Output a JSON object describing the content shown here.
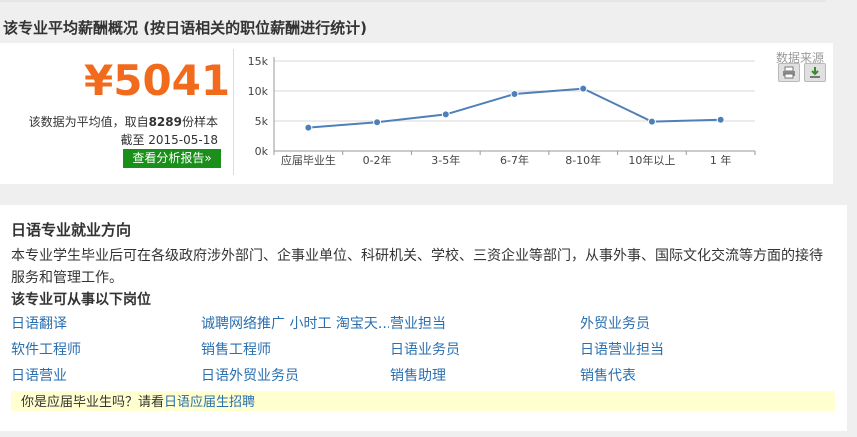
{
  "section_title": "该专业平均薪酬概况 (按日语相关的职位薪酬进行统计)",
  "salary": {
    "value": "¥5041",
    "note_prefix": "该数据为平均值，取自",
    "sample_count": "8289",
    "note_suffix": "份样本",
    "date_line": "截至 2015-05-18",
    "report_button": "查看分析报告»"
  },
  "data_source_label": "数据来源",
  "colors": {
    "accent": "#f26a1b",
    "button": "#1a8f1a",
    "link": "#2a6fb0",
    "line": "#4e7fb8"
  },
  "icons": [
    "print-icon",
    "download-icon"
  ],
  "chart_data": {
    "type": "line",
    "categories": [
      "应届毕业生",
      "0-2年",
      "3-5年",
      "6-7年",
      "8-10年",
      "10年以上",
      "1 年"
    ],
    "values": [
      3900,
      4800,
      6100,
      9500,
      10400,
      4900,
      5200
    ],
    "y_ticks": [
      "0k",
      "5k",
      "10k",
      "15k"
    ],
    "ylim": [
      0,
      15000
    ],
    "grid": true
  },
  "direction": {
    "title": "日语专业就业方向",
    "description": "本专业学生毕业后可在各级政府涉外部门、企事业单位、科研机关、学校、三资企业等部门，从事外事、国际文化交流等方面的接待服务和管理工作。",
    "positions_title": "该专业可从事以下岗位",
    "jobs": [
      "日语翻译",
      "诚聘网络推广 小时工 淘宝天...",
      "营业担当",
      "外贸业务员",
      "软件工程师",
      "销售工程师",
      "日语业务员",
      "日语营业担当",
      "日语营业",
      "日语外贸业务员",
      "销售助理",
      "销售代表"
    ]
  },
  "footer": {
    "question": "你是应届毕业生吗？请看",
    "link": "日语应届生招聘"
  }
}
